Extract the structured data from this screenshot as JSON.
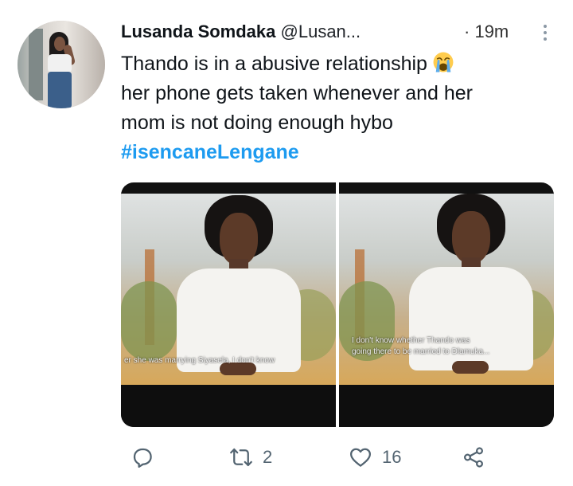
{
  "user": {
    "name": "Lusanda Somdaka",
    "handle": "@Lusan...",
    "separator": "·",
    "time": "19m"
  },
  "tweet": {
    "line1": "Thando is in a abusive relationship",
    "emoji": "loudly-crying-face-emoji",
    "line2": "her phone gets taken whenever and her",
    "line3": "mom is not doing enough hybo",
    "hashtag": "#isencaneLengane"
  },
  "media": {
    "image1_caption": "er she was marrying Siyasela, I don't know",
    "image2_caption_line1": "I don't know whether Thando was",
    "image2_caption_line2": "going there to be married to Dlamuka..."
  },
  "actions": {
    "reply_icon": "reply-icon",
    "retweet_icon": "retweet-icon",
    "retweet_count": "2",
    "like_icon": "heart-icon",
    "like_count": "16",
    "share_icon": "share-icon"
  },
  "colors": {
    "hashtag": "#1d9bf0",
    "text": "#0f1419",
    "icon": "#536471"
  }
}
